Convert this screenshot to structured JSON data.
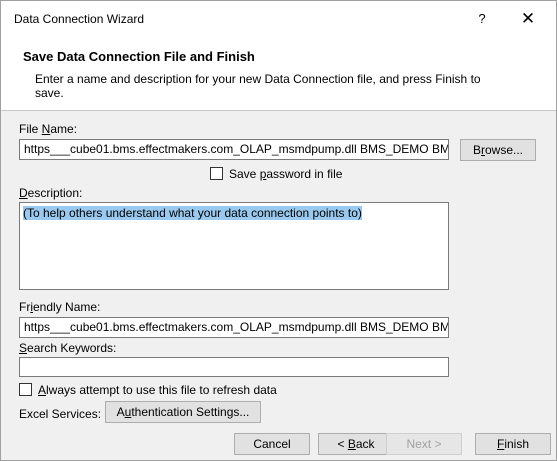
{
  "window": {
    "title": "Data Connection Wizard",
    "help_glyph": "?",
    "close_glyph": "✕"
  },
  "header": {
    "title": "Save Data Connection File and Finish",
    "description": "Enter a name and description for your new Data Connection file, and press Finish to save."
  },
  "file_name": {
    "label_pre": "File ",
    "label_key": "N",
    "label_post": "ame:",
    "value": "https___cube01.bms.effectmakers.com_OLAP_msmdpump.dll BMS_DEMO BMS",
    "browse_pre": "B",
    "browse_key": "r",
    "browse_post": "owse..."
  },
  "save_password": {
    "label_pre": "Save ",
    "label_key": "p",
    "label_post": "assword in file",
    "checked": false
  },
  "description": {
    "label_key": "D",
    "label_post": "escription:",
    "value": "(To help others understand what your data connection points to)"
  },
  "friendly_name": {
    "label_pre": "Fr",
    "label_key": "i",
    "label_post": "endly Name:",
    "value": "https___cube01.bms.effectmakers.com_OLAP_msmdpump.dll BMS_DEMO BMS"
  },
  "search_keywords": {
    "label_key": "S",
    "label_post": "earch Keywords:",
    "value": ""
  },
  "refresh": {
    "label_key": "A",
    "label_post": "lways attempt to use this file to refresh data",
    "checked": false
  },
  "excel_services": {
    "label": "Excel Services:",
    "auth_pre": "A",
    "auth_key": "u",
    "auth_post": "thentication Settings..."
  },
  "footer": {
    "cancel": "Cancel",
    "back_pre": "< ",
    "back_key": "B",
    "back_post": "ack",
    "next": "Next >",
    "finish_key": "F",
    "finish_post": "inish"
  }
}
